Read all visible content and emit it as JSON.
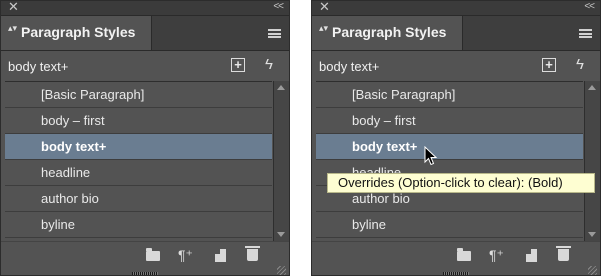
{
  "panels": [
    {
      "id": "left",
      "tab_title": "Paragraph Styles",
      "current_style": "body text+",
      "styles": [
        "[Basic Paragraph]",
        "body – first",
        "body text+",
        "headline",
        "author bio",
        "byline"
      ],
      "selected": "body text+"
    },
    {
      "id": "right",
      "tab_title": "Paragraph Styles",
      "current_style": "body text+",
      "styles": [
        "[Basic Paragraph]",
        "body – first",
        "body text+",
        "headline",
        "author bio",
        "byline"
      ],
      "selected": "body text+"
    }
  ],
  "tooltip": {
    "text": "Overrides (Option-click to clear):  (Bold)"
  },
  "glyphs": {
    "close": "✕",
    "collapse": "<<",
    "tab_arrows": "▴▾",
    "new_style": "+",
    "lightning": "ϟ",
    "pilcrow": "¶⁺"
  },
  "colors": {
    "panel_bg": "#535353",
    "selection_bg": "#6a7d91",
    "tooltip_bg": "#fefed2"
  },
  "icons": [
    "close-icon",
    "collapse-icon",
    "panel-menu-icon",
    "create-new-style-icon",
    "lightning-icon",
    "folder-icon",
    "clear-overrides-icon",
    "new-style-page-icon",
    "trash-icon",
    "resize-grip-icon",
    "cursor-icon"
  ]
}
